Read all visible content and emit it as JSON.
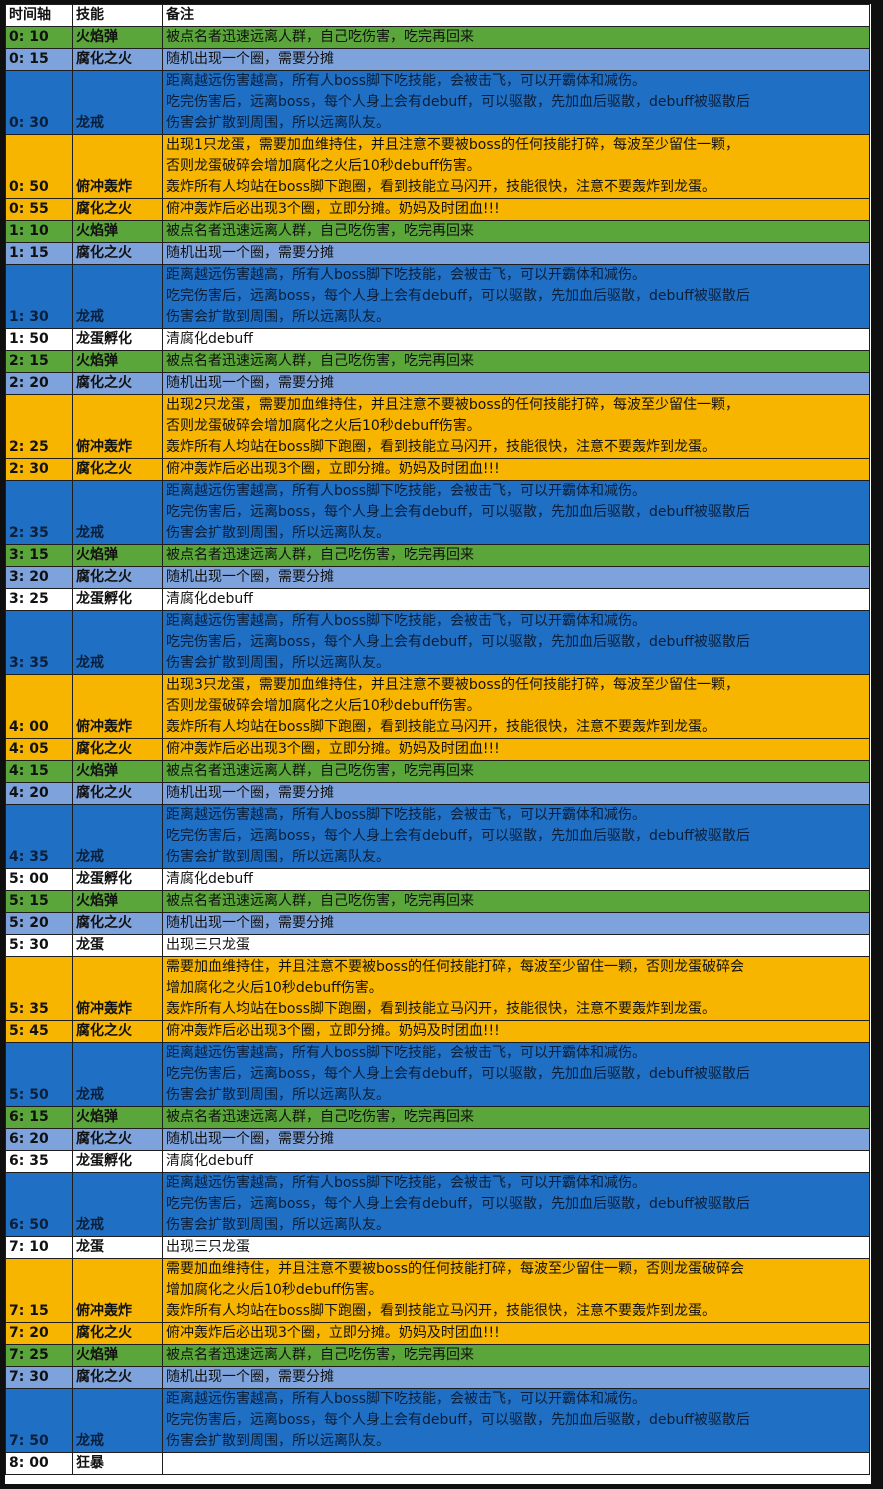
{
  "headers": [
    "时间轴",
    "技能",
    "备注"
  ],
  "rows": [
    {
      "time": "0: 10",
      "skill": "火焰弹",
      "note": "被点名者迅速远离人群，自己吃伤害，吃完再回来",
      "color": "green"
    },
    {
      "time": "0: 15",
      "skill": "腐化之火",
      "note": "随机出现一个圈，需要分摊",
      "color": "lightblue"
    },
    {
      "time": "0: 30",
      "skill": "龙戒",
      "note": "距离越远伤害越高，所有人boss脚下吃技能，会被击飞，可以开霸体和减伤。\n吃完伤害后，远离boss，每个人身上会有debuff，可以驱散，先加血后驱散，debuff被驱散后\n伤害会扩散到周围，所以远离队友。",
      "color": "blue"
    },
    {
      "time": "0: 50",
      "skill": "俯冲轰炸",
      "note": "出现1只龙蛋，需要加血维持住，并且注意不要被boss的任何技能打碎，每波至少留住一颗，\n否则龙蛋破碎会增加腐化之火后10秒debuff伤害。\n轰炸所有人均站在boss脚下跑圈，看到技能立马闪开，技能很快，注意不要轰炸到龙蛋。",
      "color": "yellow"
    },
    {
      "time": "0: 55",
      "skill": "腐化之火",
      "note": "俯冲轰炸后必出现3个圈，立即分摊。奶妈及时团血!!!",
      "color": "yellow"
    },
    {
      "time": "1: 10",
      "skill": "火焰弹",
      "note": "被点名者迅速远离人群，自己吃伤害，吃完再回来",
      "color": "green"
    },
    {
      "time": "1: 15",
      "skill": "腐化之火",
      "note": "随机出现一个圈，需要分摊",
      "color": "lightblue"
    },
    {
      "time": "1: 30",
      "skill": "龙戒",
      "note": "距离越远伤害越高，所有人boss脚下吃技能，会被击飞，可以开霸体和减伤。\n吃完伤害后，远离boss，每个人身上会有debuff，可以驱散，先加血后驱散，debuff被驱散后\n伤害会扩散到周围，所以远离队友。",
      "color": "blue"
    },
    {
      "time": "1: 50",
      "skill": "龙蛋孵化",
      "note": "清腐化debuff",
      "color": "white"
    },
    {
      "time": "2: 15",
      "skill": "火焰弹",
      "note": "被点名者迅速远离人群，自己吃伤害，吃完再回来",
      "color": "green"
    },
    {
      "time": "2: 20",
      "skill": "腐化之火",
      "note": "随机出现一个圈，需要分摊",
      "color": "lightblue"
    },
    {
      "time": "2: 25",
      "skill": "俯冲轰炸",
      "note": "出现2只龙蛋，需要加血维持住，并且注意不要被boss的任何技能打碎，每波至少留住一颗，\n否则龙蛋破碎会增加腐化之火后10秒debuff伤害。\n轰炸所有人均站在boss脚下跑圈，看到技能立马闪开，技能很快，注意不要轰炸到龙蛋。",
      "color": "yellow"
    },
    {
      "time": "2: 30",
      "skill": "腐化之火",
      "note": "俯冲轰炸后必出现3个圈，立即分摊。奶妈及时团血!!!",
      "color": "yellow"
    },
    {
      "time": "2: 35",
      "skill": "龙戒",
      "note": "距离越远伤害越高，所有人boss脚下吃技能，会被击飞，可以开霸体和减伤。\n吃完伤害后，远离boss，每个人身上会有debuff，可以驱散，先加血后驱散，debuff被驱散后\n伤害会扩散到周围，所以远离队友。",
      "color": "blue"
    },
    {
      "time": "3: 15",
      "skill": "火焰弹",
      "note": "被点名者迅速远离人群，自己吃伤害，吃完再回来",
      "color": "green"
    },
    {
      "time": "3: 20",
      "skill": "腐化之火",
      "note": "随机出现一个圈，需要分摊",
      "color": "lightblue"
    },
    {
      "time": "3: 25",
      "skill": "龙蛋孵化",
      "note": "清腐化debuff",
      "color": "white"
    },
    {
      "time": "3: 35",
      "skill": "龙戒",
      "note": "距离越远伤害越高，所有人boss脚下吃技能，会被击飞，可以开霸体和减伤。\n吃完伤害后，远离boss，每个人身上会有debuff，可以驱散，先加血后驱散，debuff被驱散后\n伤害会扩散到周围，所以远离队友。",
      "color": "blue"
    },
    {
      "time": "4: 00",
      "skill": "俯冲轰炸",
      "note": "出现3只龙蛋，需要加血维持住，并且注意不要被boss的任何技能打碎，每波至少留住一颗，\n否则龙蛋破碎会增加腐化之火后10秒debuff伤害。\n轰炸所有人均站在boss脚下跑圈，看到技能立马闪开，技能很快，注意不要轰炸到龙蛋。",
      "color": "yellow"
    },
    {
      "time": "4: 05",
      "skill": "腐化之火",
      "note": "俯冲轰炸后必出现3个圈，立即分摊。奶妈及时团血!!!",
      "color": "yellow"
    },
    {
      "time": "4: 15",
      "skill": "火焰弹",
      "note": "被点名者迅速远离人群，自己吃伤害，吃完再回来",
      "color": "green"
    },
    {
      "time": "4: 20",
      "skill": "腐化之火",
      "note": "随机出现一个圈，需要分摊",
      "color": "lightblue"
    },
    {
      "time": "4: 35",
      "skill": "龙戒",
      "note": "距离越远伤害越高，所有人boss脚下吃技能，会被击飞，可以开霸体和减伤。\n吃完伤害后，远离boss，每个人身上会有debuff，可以驱散，先加血后驱散，debuff被驱散后\n伤害会扩散到周围，所以远离队友。",
      "color": "blue"
    },
    {
      "time": "5: 00",
      "skill": "龙蛋孵化",
      "note": "清腐化debuff",
      "color": "white"
    },
    {
      "time": "5: 15",
      "skill": "火焰弹",
      "note": "被点名者迅速远离人群，自己吃伤害，吃完再回来",
      "color": "green"
    },
    {
      "time": "5: 20",
      "skill": "腐化之火",
      "note": "随机出现一个圈，需要分摊",
      "color": "lightblue"
    },
    {
      "time": "5: 30",
      "skill": "龙蛋",
      "note": "出现三只龙蛋",
      "color": "white"
    },
    {
      "time": "5: 35",
      "skill": "俯冲轰炸",
      "note": "需要加血维持住，并且注意不要被boss的任何技能打碎，每波至少留住一颗，否则龙蛋破碎会\n增加腐化之火后10秒debuff伤害。\n轰炸所有人均站在boss脚下跑圈，看到技能立马闪开，技能很快，注意不要轰炸到龙蛋。",
      "color": "yellow"
    },
    {
      "time": "5: 45",
      "skill": "腐化之火",
      "note": "俯冲轰炸后必出现3个圈，立即分摊。奶妈及时团血!!!",
      "color": "yellow"
    },
    {
      "time": "5: 50",
      "skill": "龙戒",
      "note": "距离越远伤害越高，所有人boss脚下吃技能，会被击飞，可以开霸体和减伤。\n吃完伤害后，远离boss，每个人身上会有debuff，可以驱散，先加血后驱散，debuff被驱散后\n伤害会扩散到周围，所以远离队友。",
      "color": "blue"
    },
    {
      "time": "6: 15",
      "skill": "火焰弹",
      "note": "被点名者迅速远离人群，自己吃伤害，吃完再回来",
      "color": "green"
    },
    {
      "time": "6: 20",
      "skill": "腐化之火",
      "note": "随机出现一个圈，需要分摊",
      "color": "lightblue"
    },
    {
      "time": "6: 35",
      "skill": "龙蛋孵化",
      "note": "清腐化debuff",
      "color": "white"
    },
    {
      "time": "6: 50",
      "skill": "龙戒",
      "note": "距离越远伤害越高，所有人boss脚下吃技能，会被击飞，可以开霸体和减伤。\n吃完伤害后，远离boss，每个人身上会有debuff，可以驱散，先加血后驱散，debuff被驱散后\n伤害会扩散到周围，所以远离队友。",
      "color": "blue"
    },
    {
      "time": "7: 10",
      "skill": "龙蛋",
      "note": "出现三只龙蛋",
      "color": "white"
    },
    {
      "time": "7: 15",
      "skill": "俯冲轰炸",
      "note": "需要加血维持住，并且注意不要被boss的任何技能打碎，每波至少留住一颗，否则龙蛋破碎会\n增加腐化之火后10秒debuff伤害。\n轰炸所有人均站在boss脚下跑圈，看到技能立马闪开，技能很快，注意不要轰炸到龙蛋。",
      "color": "yellow"
    },
    {
      "time": "7: 20",
      "skill": "腐化之火",
      "note": "俯冲轰炸后必出现3个圈，立即分摊。奶妈及时团血!!!",
      "color": "yellow"
    },
    {
      "time": "7: 25",
      "skill": "火焰弹",
      "note": "被点名者迅速远离人群，自己吃伤害，吃完再回来",
      "color": "green"
    },
    {
      "time": "7: 30",
      "skill": "腐化之火",
      "note": "随机出现一个圈，需要分摊",
      "color": "lightblue"
    },
    {
      "time": "7: 50",
      "skill": "龙戒",
      "note": "距离越远伤害越高，所有人boss脚下吃技能，会被击飞，可以开霸体和减伤。\n吃完伤害后，远离boss，每个人身上会有debuff，可以驱散，先加血后驱散，debuff被驱散后\n伤害会扩散到周围，所以远离队友。",
      "color": "blue"
    },
    {
      "time": "8: 00",
      "skill": "狂暴",
      "note": "",
      "color": "white"
    }
  ]
}
